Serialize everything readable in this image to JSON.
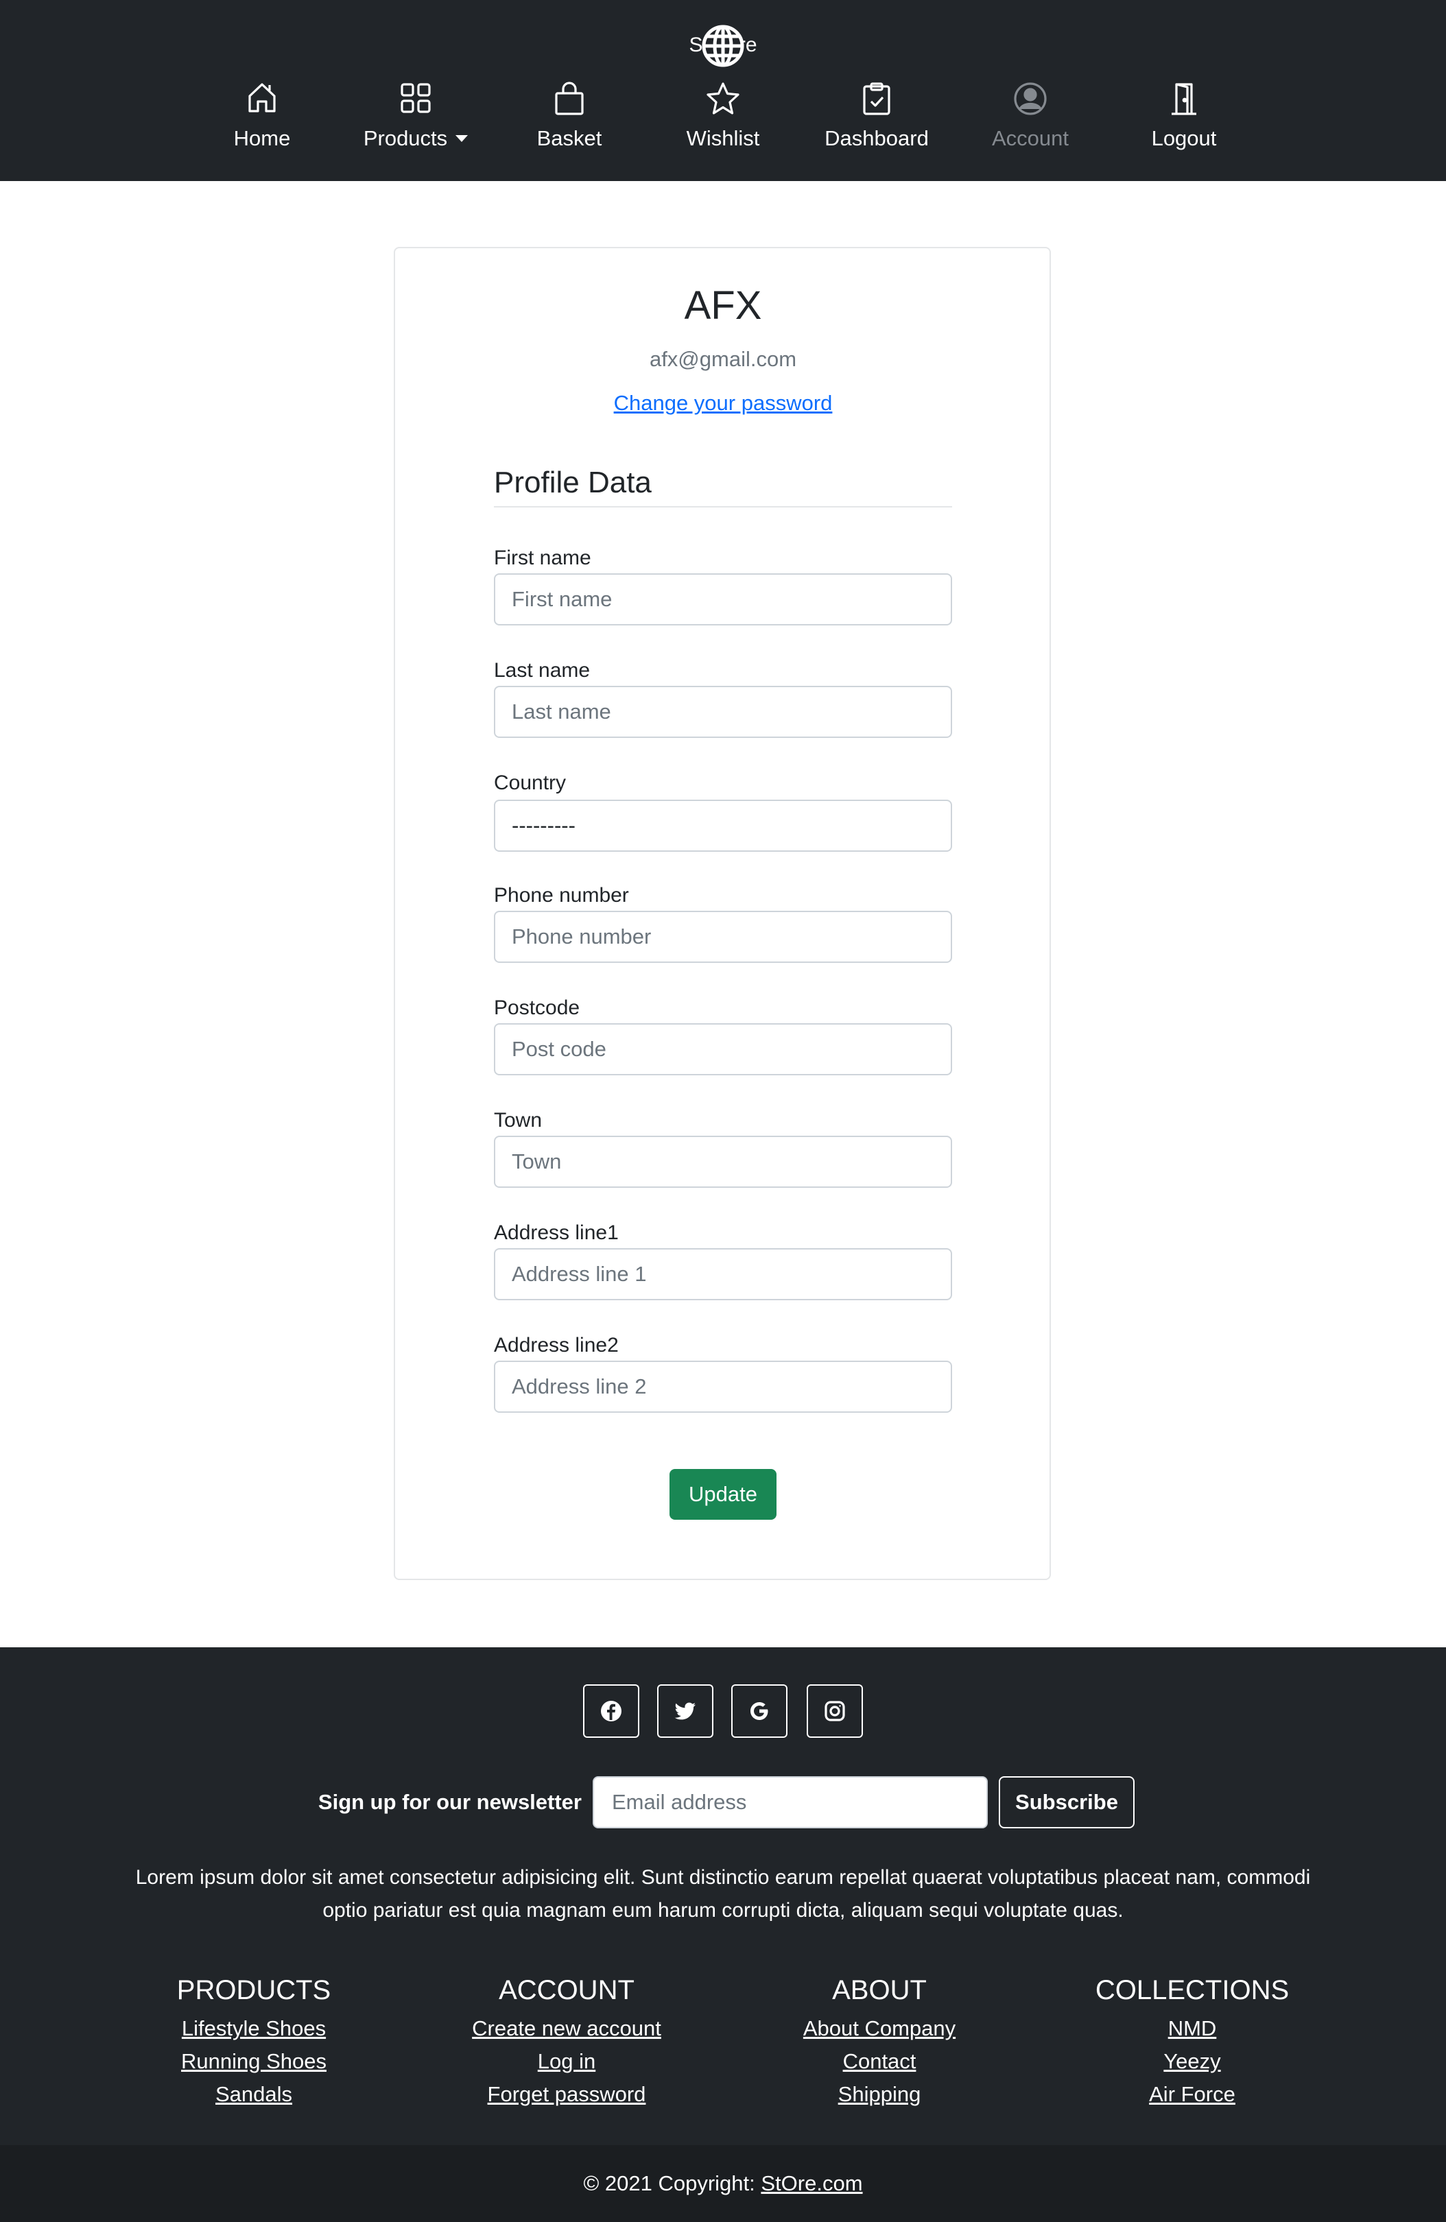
{
  "brand": {
    "text_left": "St",
    "text_right": "re",
    "icon": "globe-icon"
  },
  "nav": {
    "items": [
      {
        "label": "Home",
        "icon": "house-icon"
      },
      {
        "label": "Products",
        "icon": "grid-icon"
      },
      {
        "label": "Basket",
        "icon": "bag-icon"
      },
      {
        "label": "Wishlist",
        "icon": "star-icon"
      },
      {
        "label": "Dashboard",
        "icon": "clipboard-check-icon"
      },
      {
        "label": "Account",
        "icon": "person-circle-icon"
      },
      {
        "label": "Logout",
        "icon": "door-icon"
      }
    ]
  },
  "profile": {
    "name": "AFX",
    "email": "afx@gmail.com",
    "change_password": "Change your password",
    "section_title": "Profile Data",
    "fields": [
      {
        "label": "First name",
        "placeholder": "First name"
      },
      {
        "label": "Last name",
        "placeholder": "Last name"
      },
      {
        "label": "Country",
        "value": "---------"
      },
      {
        "label": "Phone number",
        "placeholder": "Phone number"
      },
      {
        "label": "Postcode",
        "placeholder": "Post code"
      },
      {
        "label": "Town",
        "placeholder": "Town"
      },
      {
        "label": "Address line1",
        "placeholder": "Address line 1"
      },
      {
        "label": "Address line2",
        "placeholder": "Address line 2"
      }
    ],
    "update_label": "Update"
  },
  "footer": {
    "social": [
      "facebook-icon",
      "twitter-icon",
      "google-icon",
      "instagram-icon"
    ],
    "newsletter_label": "Sign up for our newsletter",
    "email_placeholder": "Email address",
    "subscribe_label": "Subscribe",
    "about_text": "Lorem ipsum dolor sit amet consectetur adipisicing elit. Sunt distinctio earum repellat quaerat voluptatibus placeat nam, commodi optio pariatur est quia magnam eum harum corrupti dicta, aliquam sequi voluptate quas.",
    "columns": [
      {
        "title": "PRODUCTS",
        "links": [
          "Lifestyle Shoes",
          "Running Shoes",
          "Sandals"
        ]
      },
      {
        "title": "ACCOUNT",
        "links": [
          "Create new account",
          "Log in",
          "Forget password"
        ]
      },
      {
        "title": "ABOUT",
        "links": [
          "About Company",
          "Contact",
          "Shipping"
        ]
      },
      {
        "title": "COLLECTIONS",
        "links": [
          "NMD",
          "Yeezy",
          "Air Force"
        ]
      }
    ],
    "copyright_prefix": "© 2021 Copyright:",
    "copyright_link": "StOre.com"
  },
  "colors": {
    "navbar_bg": "#212529",
    "link": "#0d6efd",
    "update_button": "#198754",
    "disabled_nav": "#858a90"
  }
}
